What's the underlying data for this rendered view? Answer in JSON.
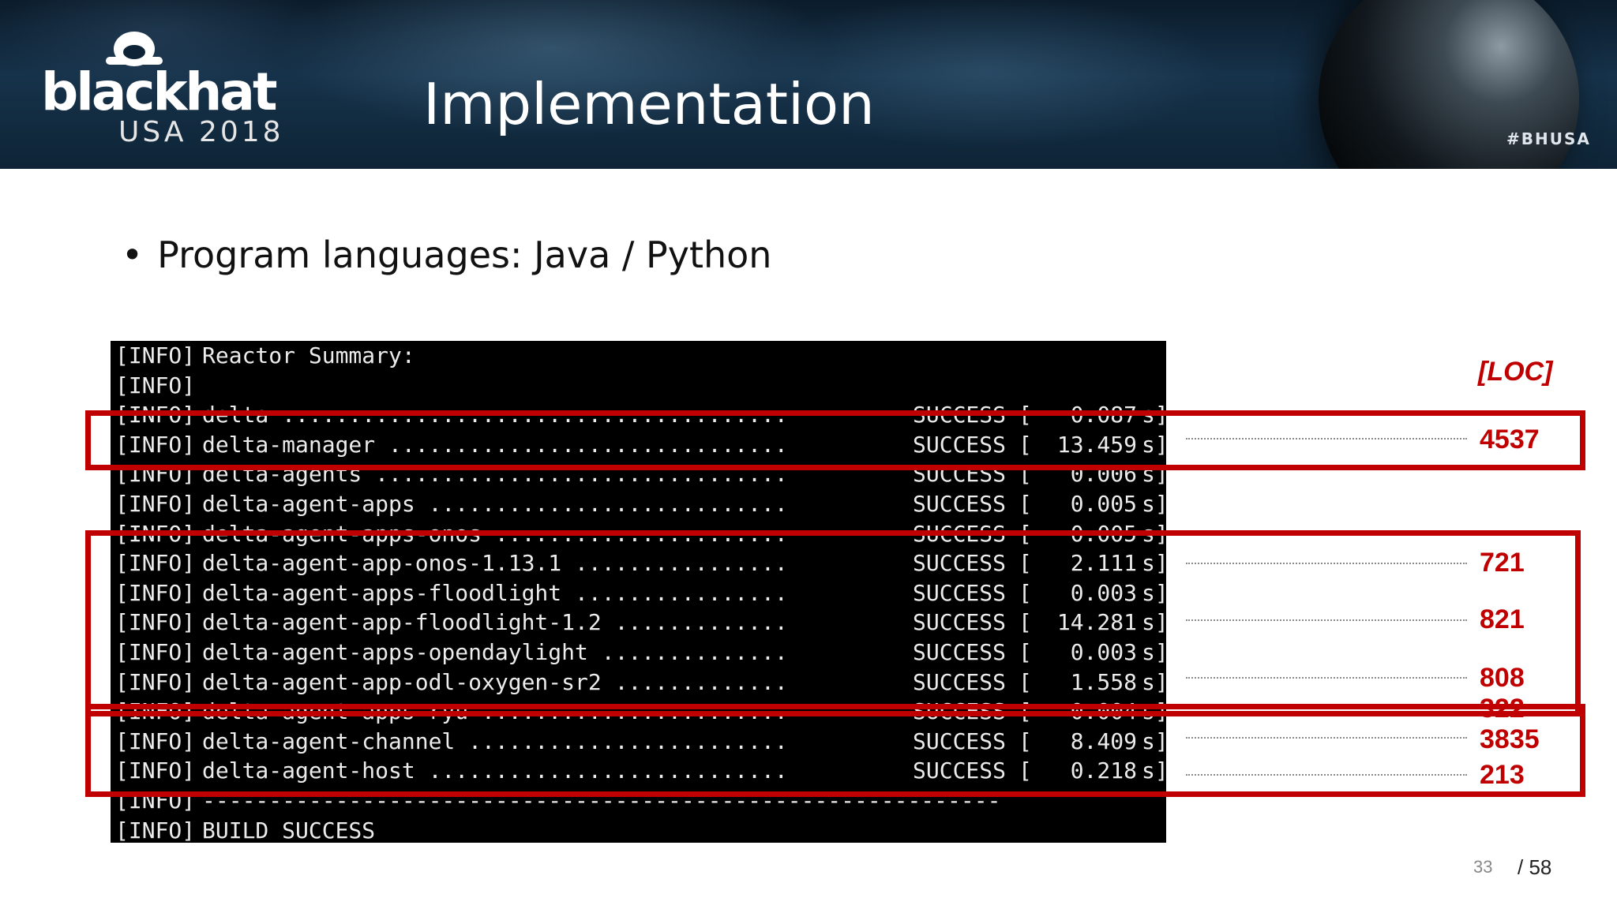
{
  "header": {
    "logo_text": "blackhat",
    "logo_sub": "USA 2018",
    "title": "Implementation",
    "hashtag": "#BHUSA"
  },
  "bullet": {
    "symbol": "•",
    "text": "Program languages: Java / Python"
  },
  "terminal": {
    "lines": [
      {
        "tag": "[INFO]",
        "name": "Reactor Summary:",
        "status": "",
        "time": ""
      },
      {
        "tag": "[INFO]",
        "name": "",
        "status": "",
        "time": ""
      },
      {
        "tag": "[INFO]",
        "name": "delta ......................................",
        "status": "SUCCESS",
        "time": "0.087"
      },
      {
        "tag": "[INFO]",
        "name": "delta-manager ..............................",
        "status": "SUCCESS",
        "time": "13.459"
      },
      {
        "tag": "[INFO]",
        "name": "delta-agents ...............................",
        "status": "SUCCESS",
        "time": "0.006"
      },
      {
        "tag": "[INFO]",
        "name": "delta-agent-apps ...........................",
        "status": "SUCCESS",
        "time": "0.005"
      },
      {
        "tag": "[INFO]",
        "name": "delta-agent-apps-onos ......................",
        "status": "SUCCESS",
        "time": "0.005"
      },
      {
        "tag": "[INFO]",
        "name": "delta-agent-app-onos-1.13.1 ................",
        "status": "SUCCESS",
        "time": "2.111"
      },
      {
        "tag": "[INFO]",
        "name": "delta-agent-apps-floodlight ................",
        "status": "SUCCESS",
        "time": "0.003"
      },
      {
        "tag": "[INFO]",
        "name": "delta-agent-app-floodlight-1.2 .............",
        "status": "SUCCESS",
        "time": "14.281"
      },
      {
        "tag": "[INFO]",
        "name": "delta-agent-apps-opendaylight ..............",
        "status": "SUCCESS",
        "time": "0.003"
      },
      {
        "tag": "[INFO]",
        "name": "delta-agent-app-odl-oxygen-sr2 .............",
        "status": "SUCCESS",
        "time": "1.558"
      },
      {
        "tag": "[INFO]",
        "name": "delta-agent-apps-ryu .......................",
        "status": "SUCCESS",
        "time": "0.004"
      },
      {
        "tag": "[INFO]",
        "name": "delta-agent-channel ........................",
        "status": "SUCCESS",
        "time": "8.409"
      },
      {
        "tag": "[INFO]",
        "name": "delta-agent-host ...........................",
        "status": "SUCCESS",
        "time": "0.218"
      },
      {
        "tag": "[INFO]",
        "name": "------------------------------------------------------------",
        "status": "",
        "time": ""
      },
      {
        "tag": "[INFO]",
        "name": "BUILD SUCCESS",
        "status": "",
        "time": ""
      }
    ]
  },
  "loc": {
    "header": "[LOC]",
    "values": [
      "4537",
      "721",
      "821",
      "808",
      "322",
      "3835",
      "213"
    ]
  },
  "page": {
    "current": "33",
    "total": "/ 58"
  },
  "colors": {
    "accent_red": "#c00000",
    "terminal_bg": "#000000",
    "terminal_text": "#ececec"
  }
}
